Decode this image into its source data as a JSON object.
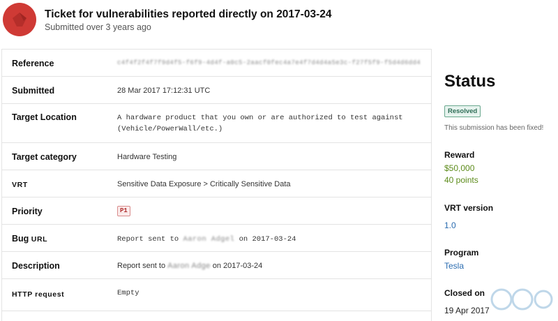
{
  "header": {
    "title": "Ticket for vulnerabilities reported directly on 2017-03-24",
    "subtitle": "Submitted over 3 years ago"
  },
  "details": [
    {
      "label": "Reference",
      "value": "c4f4f2f4f7f9d4f5-f6f9-4d4f-a0c5-2aacf0fec4a7e4f7d4d4a5e3c-f27f5f9-f5d4d6dd4",
      "blurred": true
    },
    {
      "label": "Submitted",
      "value": "28 Mar 2017 17:12:31 UTC"
    },
    {
      "label": "Target Location",
      "value": "A hardware product that you own or are authorized to test against",
      "value2": "(Vehicle/PowerWall/etc.)"
    },
    {
      "label": "Target category",
      "value": "Hardware Testing"
    },
    {
      "label": "VRT",
      "value": "Sensitive Data Exposure > Critically Sensitive Data"
    },
    {
      "label": "Priority",
      "value": "P1"
    },
    {
      "label": "Bug URL",
      "prefix": "Report sent to",
      "redacted": "Aaron Adgel",
      "suffix": "on 2017-03-24"
    },
    {
      "label": "Description",
      "prefix": "Report sent to",
      "redacted": "Aaron Adge",
      "suffix": "on 2017-03-24"
    },
    {
      "label": "HTTP request",
      "value": "Empty"
    }
  ],
  "sidebar": {
    "status_heading": "Status",
    "status_badge": "Resolved",
    "status_text": "This submission has been fixed!",
    "reward_label": "Reward",
    "reward_amount": "$50,000",
    "reward_points": "40 points",
    "vrt_version_label": "VRT version",
    "vrt_version": "1.0",
    "program_label": "Program",
    "program": "Tesla",
    "closed_label": "Closed on",
    "closed_date": "19 Apr 2017"
  },
  "colors": {
    "avatar": "#cf3a35",
    "reward": "#5c8b1a",
    "link": "#2b6cb0",
    "resolved": "#2f6e57"
  }
}
